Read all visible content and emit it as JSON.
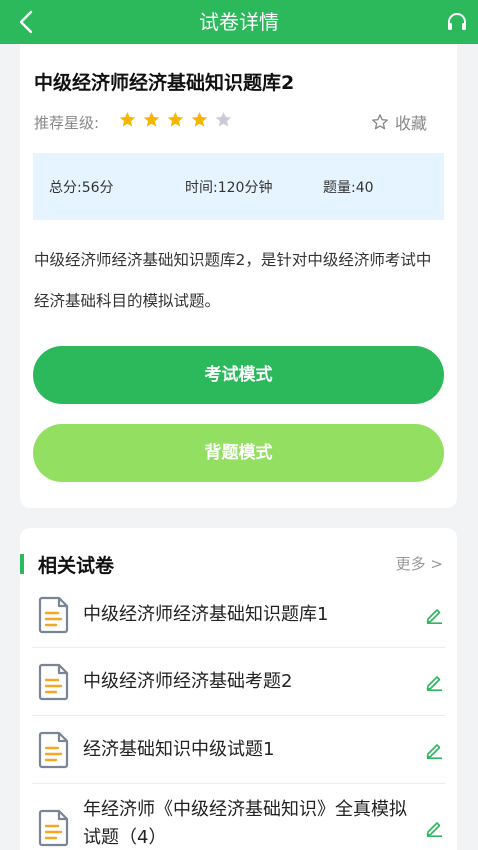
{
  "header": {
    "title": "试卷详情",
    "back_icon": "back-arrow-icon",
    "headset_icon": "headset-icon"
  },
  "exam": {
    "title": "中级经济师经济基础知识题库2",
    "rating_label": "推荐星级:",
    "rating": 4,
    "rating_max": 5,
    "favorite_label": "收藏",
    "score_label": "总分:56分",
    "time_label": "时间:120分钟",
    "count_label": "题量:40",
    "description": "中级经济师经济基础知识题库2，是针对中级经济师考试中经济基础科目的模拟试题。",
    "exam_mode_label": "考试模式",
    "study_mode_label": "背题模式"
  },
  "related": {
    "title": "相关试卷",
    "more_label": "更多 >",
    "items": [
      {
        "name": "中级经济师经济基础知识题库1"
      },
      {
        "name": "中级经济师经济基础考题2"
      },
      {
        "name": "经济基础知识中级试题1"
      },
      {
        "name": "年经济师《中级经济基础知识》全真模拟试题（4）"
      }
    ]
  },
  "colors": {
    "primary": "#2bb95b",
    "secondary": "#92df62",
    "star": "#f7b500",
    "star_empty": "#c9ccd6",
    "info_bg": "#e6f4ff"
  }
}
